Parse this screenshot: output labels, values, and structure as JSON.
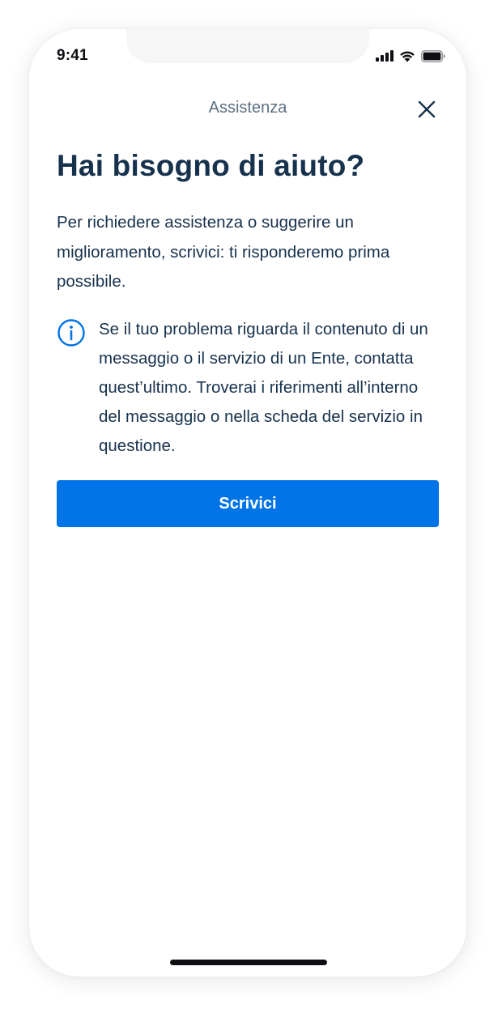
{
  "status_bar": {
    "time": "9:41",
    "icons": [
      "cellular-signal-icon",
      "wifi-icon",
      "battery-icon"
    ]
  },
  "header": {
    "title": "Assistenza",
    "close_icon": "close-icon"
  },
  "main": {
    "heading": "Hai bisogno di aiuto?",
    "intro": "Per richiedere assistenza o suggerire un miglioramento, scrivici: ti risponderemo prima possibile.",
    "info": {
      "icon": "info-icon",
      "text": "Se il tuo problema riguarda il contenuto di un messaggio o il servizio di un Ente, contatta quest’ultimo. Troverai i riferimenti all’interno del messaggio o nella scheda del servizio in questione."
    },
    "cta_label": "Scrivici"
  },
  "colors": {
    "primary": "#0073e6",
    "text_dark": "#17324d",
    "text_muted": "#5c6f82"
  }
}
